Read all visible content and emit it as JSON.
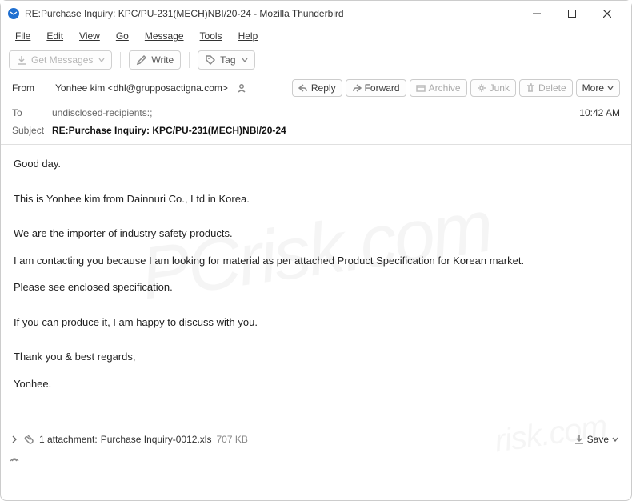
{
  "window": {
    "title": "RE:Purchase Inquiry: KPC/PU-231(MECH)NBI/20-24 - Mozilla Thunderbird"
  },
  "menu": {
    "file": "File",
    "edit": "Edit",
    "view": "View",
    "go": "Go",
    "message": "Message",
    "tools": "Tools",
    "help": "Help"
  },
  "toolbar": {
    "get_messages": "Get Messages",
    "write": "Write",
    "tag": "Tag"
  },
  "headers": {
    "from_label": "From",
    "from_value": "Yonhee kim <dhl@grupposactigna.com>",
    "to_label": "To",
    "to_value": "undisclosed-recipients:;",
    "subject_label": "Subject",
    "subject_value": "RE:Purchase Inquiry: KPC/PU-231(MECH)NBI/20-24",
    "time": "10:42 AM"
  },
  "actions": {
    "reply": "Reply",
    "forward": "Forward",
    "archive": "Archive",
    "junk": "Junk",
    "delete": "Delete",
    "more": "More"
  },
  "body": {
    "p1": "Good day.",
    "p2": "This is Yonhee kim from Dainnuri Co., Ltd in Korea.",
    "p3": "We are the importer of industry safety products.",
    "p4": "I am contacting you because I am looking for material as per attached Product Specification for Korean market.",
    "p5": "Please see enclosed specification.",
    "p6": "If you can produce it, I am happy to discuss with you.",
    "p7": "Thank you & best regards,",
    "p8": "Yonhee."
  },
  "attachment": {
    "count_label": "1 attachment:",
    "filename": "Purchase Inquiry-0012.xls",
    "size": "707 KB",
    "save": "Save"
  },
  "watermark": {
    "main": "PCrisk.com",
    "small": "risk.com"
  }
}
